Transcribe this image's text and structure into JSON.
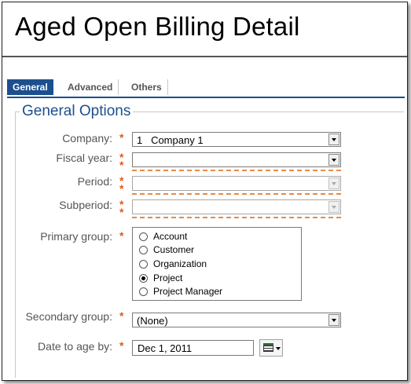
{
  "page_title": "Aged Open Billing Detail",
  "tabs": [
    "General",
    "Advanced",
    "Others"
  ],
  "section_title": "General Options",
  "required_mark": "*",
  "fields": {
    "company": {
      "label": "Company:",
      "value": "1   Company 1"
    },
    "fiscal_year": {
      "label": "Fiscal year:",
      "value": ""
    },
    "period": {
      "label": "Period:",
      "value": ""
    },
    "subperiod": {
      "label": "Subperiod:",
      "value": ""
    },
    "primary_group": {
      "label": "Primary group:",
      "options": [
        "Account",
        "Customer",
        "Organization",
        "Project",
        "Project Manager"
      ],
      "selected": "Project"
    },
    "secondary_group": {
      "label": "Secondary group:",
      "value": "(None)"
    },
    "date_to_age_by": {
      "label": "Date to age by:",
      "value": "Dec 1, 2011"
    }
  },
  "colors": {
    "accent": "#1c4f8e",
    "required": "#e55a12",
    "tab_active_text": "#ffffff"
  },
  "icons": [
    "calendar-icon",
    "chevron-down-icon"
  ]
}
